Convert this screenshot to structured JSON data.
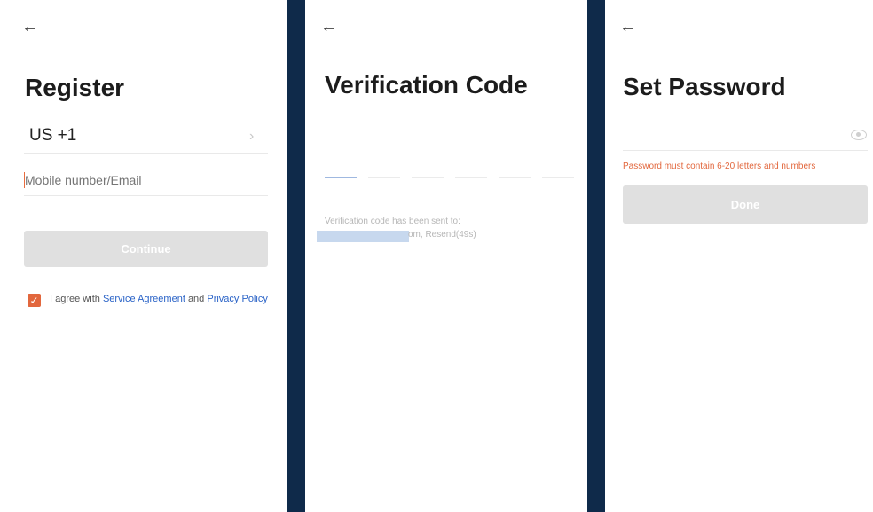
{
  "register": {
    "back_icon": "←",
    "title": "Register",
    "country_code": "US +1",
    "chevron": "›",
    "mobile_placeholder": "Mobile number/Email",
    "continue_label": "Continue",
    "agree_prefix": "I agree with",
    "service_agreement": "Service Agreement",
    "and_text": "and",
    "privacy_policy": "Privacy Policy",
    "checkbox_mark": "✓"
  },
  "verification": {
    "back_icon": "←",
    "title": "Verification Code",
    "sent_text": "Verification code has been sent to:",
    "resend_text": "om, Resend(49s)"
  },
  "set_password": {
    "back_icon": "←",
    "title": "Set Password",
    "error_text": "Password must contain 6-20 letters and numbers",
    "done_label": "Done"
  },
  "colors": {
    "accent": "#e2673d",
    "link": "#2a63c7",
    "divider": "#0f2a4a",
    "button_disabled": "#e0e0e0"
  }
}
